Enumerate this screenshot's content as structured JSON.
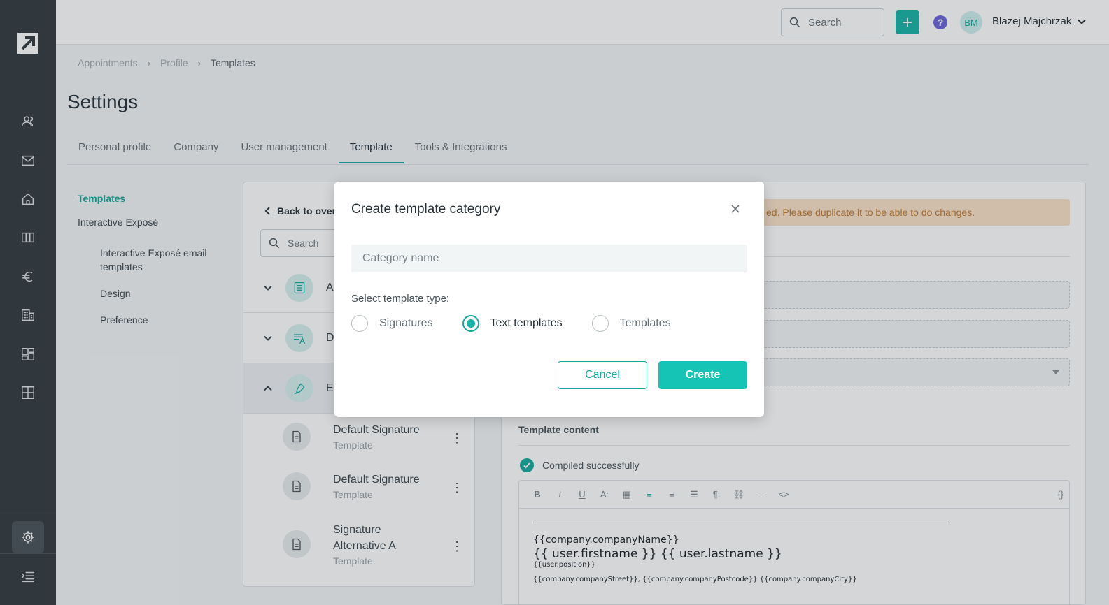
{
  "topbar": {
    "search_placeholder": "Search",
    "add_label": "+",
    "help_label": "?",
    "avatar_initials": "BM",
    "user_name": "Blazej Majchrzak"
  },
  "breadcrumb": {
    "items": [
      "Appointments",
      "Profile",
      "Templates"
    ],
    "separator": "›"
  },
  "page": {
    "title": "Settings",
    "tabs": [
      "Personal profile",
      "Company",
      "User management",
      "Template",
      "Tools & Integrations"
    ],
    "active_tab": "Template"
  },
  "sidenav": {
    "items": [
      {
        "label": "Templates",
        "active": true
      },
      {
        "label": "Interactive Exposé"
      },
      {
        "label": "Interactive Exposé email templates"
      },
      {
        "label": "Design"
      },
      {
        "label": "Preference"
      }
    ]
  },
  "middle": {
    "back_label": "Back to over",
    "search_placeholder": "Search",
    "categories": [
      {
        "label": "Ap",
        "icon": "document-list-icon",
        "expanded": false
      },
      {
        "label": "De",
        "icon": "text-font-icon",
        "expanded": false
      },
      {
        "label": "Em",
        "icon": "pen-signature-icon",
        "expanded": true
      }
    ],
    "templates": [
      {
        "name": "Default Signature",
        "type": "Template"
      },
      {
        "name": "Default Signature",
        "type": "Template"
      },
      {
        "name": "Signature Alternative A",
        "type": "Template"
      }
    ]
  },
  "right": {
    "warning": "ed. Please duplicate it to be able to do changes.",
    "section_title": "Template content",
    "compiled_status": "Compiled successfully",
    "toolbar": [
      "B",
      "i",
      "U",
      "A:",
      "▦",
      "≡",
      "≡",
      "☰",
      "¶:",
      "⛓",
      "—",
      "<>"
    ],
    "toolbar_right": "{}",
    "editor_lines": [
      "{{company.companyName}}",
      "{{ user.firstname }} {{ user.lastname }}",
      "{{user.position}}",
      "{{company.companyStreet}}, {{company.companyPostcode}} {{company.companyCity}}"
    ]
  },
  "modal": {
    "title": "Create template category",
    "input_placeholder": "Category name",
    "type_label": "Select template type:",
    "options": [
      "Signatures",
      "Text templates",
      "Templates"
    ],
    "selected_option": "Text templates",
    "cancel_label": "Cancel",
    "create_label": "Create"
  },
  "colors": {
    "accent": "#16b3a6",
    "rail": "#33393e",
    "warning_bg": "#fbe2c7",
    "warning_text": "#c0782e",
    "help": "#6b63d8"
  }
}
